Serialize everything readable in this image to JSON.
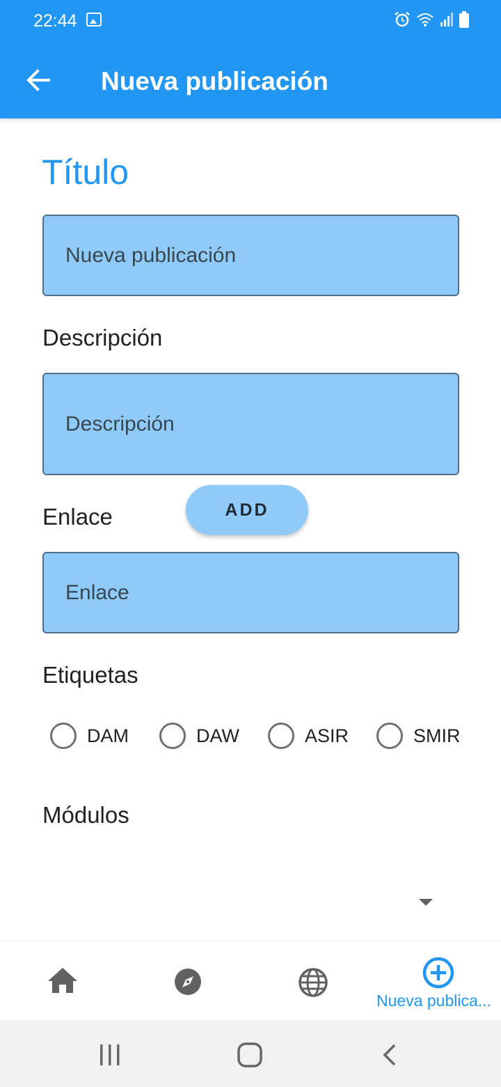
{
  "status_bar": {
    "time": "22:44",
    "icons": [
      "image-icon",
      "alarm-icon",
      "wifi-icon",
      "signal-icon",
      "battery-icon"
    ]
  },
  "app_bar": {
    "title": "Nueva publicación",
    "back_icon": "back-arrow-icon",
    "background_color": "#2196F3"
  },
  "form": {
    "title_label": "Título",
    "title_value": "Nueva publicación",
    "description_label": "Descripción",
    "description_placeholder": "Descripción",
    "link_label": "Enlace",
    "link_placeholder": "Enlace",
    "add_button": "ADD",
    "tags_label": "Etiquetas",
    "tags": [
      {
        "label": "DAM",
        "checked": false
      },
      {
        "label": "DAW",
        "checked": false
      },
      {
        "label": "ASIR",
        "checked": false
      },
      {
        "label": "SMIR",
        "checked": false
      }
    ],
    "modules_label": "Módulos",
    "input_color": "#90CAF9"
  },
  "bottom_nav": {
    "items": [
      {
        "icon": "home-icon",
        "label": ""
      },
      {
        "icon": "compass-icon",
        "label": ""
      },
      {
        "icon": "globe-icon",
        "label": ""
      },
      {
        "icon": "add-circle-icon",
        "label": "Nueva publica..."
      }
    ],
    "active_color": "#2196F3"
  },
  "system_nav": {
    "icons": [
      "recents-icon",
      "home-button-icon",
      "back-button-icon"
    ]
  }
}
